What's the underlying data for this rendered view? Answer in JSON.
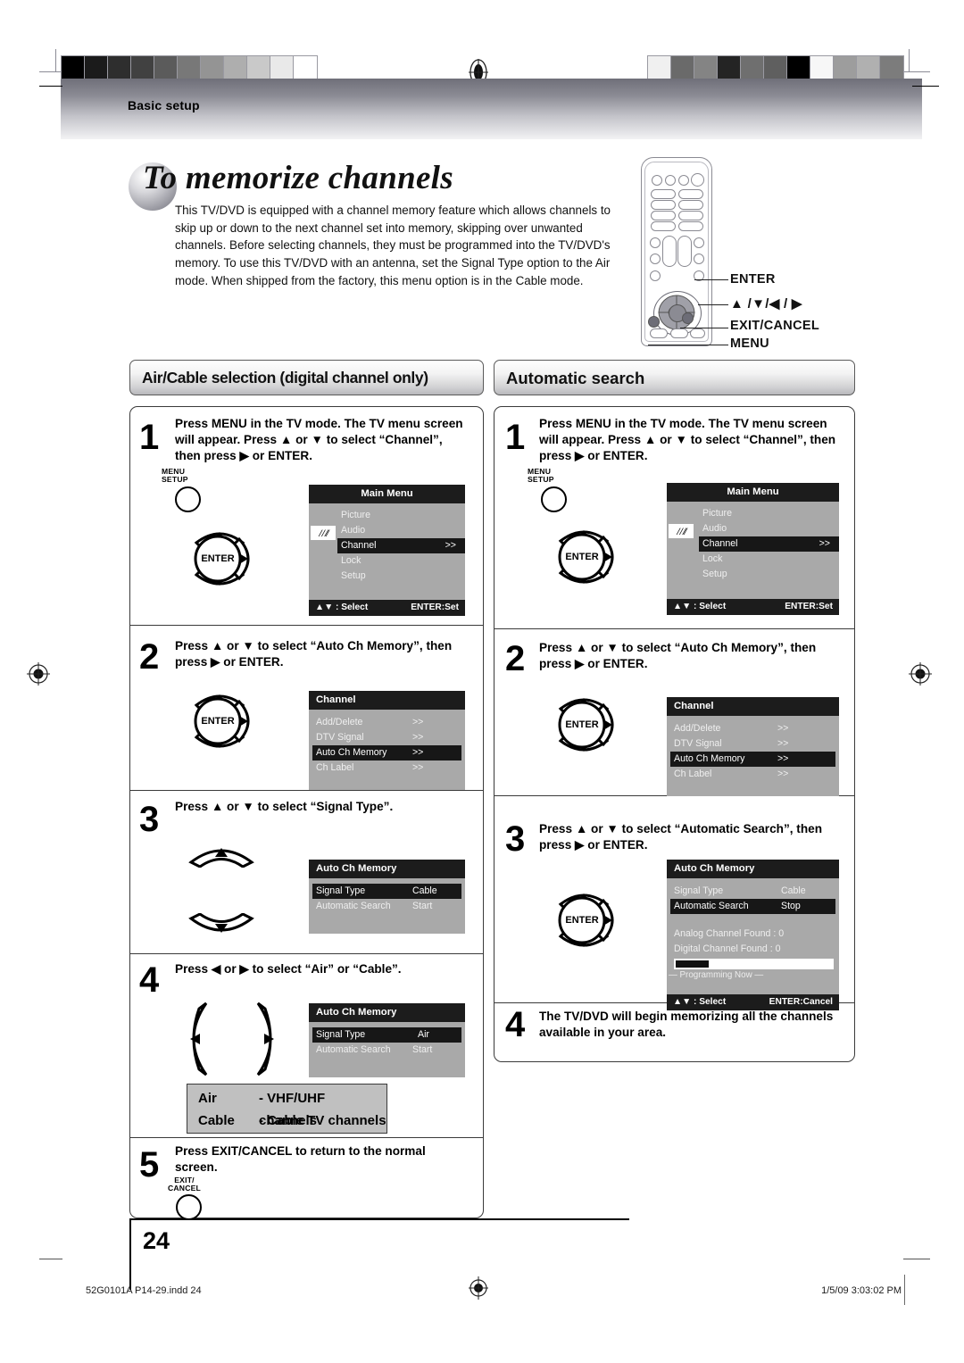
{
  "header": {
    "section_label": "Basic setup"
  },
  "title": {
    "lead": "To",
    "rest": "memorize channels"
  },
  "intro": "This TV/DVD is equipped with a channel memory feature which allows channels to skip up or down to the next channel set into memory, skipping over unwanted channels. Before selecting channels, they must be programmed into the TV/DVD's memory. To use this TV/DVD with an antenna, set the Signal Type option to the Air mode. When shipped from the factory, this menu option is in the Cable mode.",
  "remote_callouts": [
    "ENTER",
    "▲ /▼/◀ / ▶",
    "EXIT/CANCEL",
    "MENU"
  ],
  "left_column": {
    "heading": "Air/Cable selection (digital channel only)",
    "steps": [
      {
        "number": "1",
        "text": "Press MENU in the TV mode. The TV menu screen will appear. Press ▲ or ▼ to select “Channel”, then press ▶ or ENTER.",
        "button_caption": "MENU\nSETUP",
        "enter_label": "ENTER",
        "osd": {
          "title": "Main Menu",
          "title_align": "center",
          "rows": [
            {
              "label": "Picture",
              "value": "",
              "highlight": false
            },
            {
              "label": "Audio",
              "value": "",
              "highlight": false
            },
            {
              "label": "Channel",
              "value": ">>",
              "highlight": true
            },
            {
              "label": "Lock",
              "value": "",
              "highlight": false
            },
            {
              "label": "Setup",
              "value": "",
              "highlight": false
            }
          ],
          "footer_left": "▲▼ : Select",
          "footer_right": "ENTER:Set",
          "antenna_icon": "antenna-icon"
        }
      },
      {
        "number": "2",
        "text": "Press ▲ or ▼ to select “Auto Ch Memory”, then press ▶ or ENTER.",
        "enter_label": "ENTER",
        "osd": {
          "title": "Channel",
          "title_align": "left",
          "rows": [
            {
              "label": "Add/Delete",
              "value": ">>",
              "highlight": false
            },
            {
              "label": "DTV Signal",
              "value": ">>",
              "highlight": false
            },
            {
              "label": "Auto Ch Memory",
              "value": ">>",
              "highlight": true
            },
            {
              "label": "Ch Label",
              "value": ">>",
              "highlight": false
            }
          ]
        }
      },
      {
        "number": "3",
        "text": "Press ▲ or ▼ to select “Signal Type”.",
        "osd": {
          "title": "Auto Ch Memory",
          "title_align": "left",
          "rows": [
            {
              "label": "Signal Type",
              "value": "Cable",
              "highlight": true
            },
            {
              "label": "Automatic Search",
              "value": "Start",
              "highlight": false
            }
          ]
        }
      },
      {
        "number": "4",
        "text": "Press ◀ or ▶ to select “Air” or “Cable”.",
        "osd": {
          "title": "Auto Ch Memory",
          "title_align": "left",
          "rows": [
            {
              "label": "Signal Type",
              "value": "Air",
              "highlight": true
            },
            {
              "label": "Automatic Search",
              "value": "Start",
              "highlight": false
            }
          ]
        }
      },
      {
        "number": "5",
        "text": "Press EXIT/CANCEL to return to the normal screen.",
        "button_caption": "EXIT/\nCANCEL"
      }
    ],
    "legend": [
      {
        "key": "Air",
        "value": "- VHF/UHF channels"
      },
      {
        "key": "Cable",
        "value": "- Cable TV channels"
      }
    ]
  },
  "right_column": {
    "heading": "Automatic search",
    "steps": [
      {
        "number": "1",
        "text": "Press MENU in the TV mode. The TV menu screen will appear. Press ▲ or ▼ to select “Channel”, then press ▶ or ENTER.",
        "button_caption": "MENU\nSETUP",
        "enter_label": "ENTER",
        "osd": {
          "title": "Main Menu",
          "title_align": "center",
          "rows": [
            {
              "label": "Picture",
              "value": "",
              "highlight": false
            },
            {
              "label": "Audio",
              "value": "",
              "highlight": false
            },
            {
              "label": "Channel",
              "value": ">>",
              "highlight": true
            },
            {
              "label": "Lock",
              "value": "",
              "highlight": false
            },
            {
              "label": "Setup",
              "value": "",
              "highlight": false
            }
          ],
          "footer_left": "▲▼ : Select",
          "footer_right": "ENTER:Set",
          "antenna_icon": "antenna-icon"
        }
      },
      {
        "number": "2",
        "text": "Press ▲ or ▼ to select “Auto Ch Memory”, then press ▶ or ENTER.",
        "enter_label": "ENTER",
        "osd": {
          "title": "Channel",
          "title_align": "left",
          "rows": [
            {
              "label": "Add/Delete",
              "value": ">>",
              "highlight": false
            },
            {
              "label": "DTV Signal",
              "value": ">>",
              "highlight": false
            },
            {
              "label": "Auto Ch Memory",
              "value": ">>",
              "highlight": true
            },
            {
              "label": "Ch Label",
              "value": ">>",
              "highlight": false
            }
          ]
        }
      },
      {
        "number": "3",
        "text": "Press ▲ or ▼ to select “Automatic Search”, then press ▶ or ENTER.",
        "enter_label": "ENTER",
        "osd": {
          "title": "Auto Ch Memory",
          "title_align": "left",
          "rows": [
            {
              "label": "Signal Type",
              "value": "Cable",
              "highlight": false
            },
            {
              "label": "Automatic Search",
              "value": "Stop",
              "highlight": true
            }
          ],
          "analog_found": "Analog Channel Found : 0",
          "digital_found": "Digital Channel Found : 0",
          "progress_label": "— Programming Now —",
          "progress_percent": 21,
          "footer_left": "▲▼ : Select",
          "footer_right": "ENTER:Cancel"
        }
      },
      {
        "number": "4",
        "text": "The TV/DVD will begin memorizing all the channels available in your area."
      }
    ]
  },
  "footer": {
    "page_number": "24",
    "file_name": "52G0101A  P14-29.indd   24",
    "timestamp": "1/5/09   3:03:02 PM"
  },
  "colorbars": {
    "left": [
      "#000000",
      "#1b1b1b",
      "#2e2e2e",
      "#414141",
      "#5b5b5b",
      "#787878",
      "#949494",
      "#aeaeae",
      "#c9c9c9",
      "#e9e9e9",
      "#ffffff"
    ],
    "right": [
      "#f0f0f0",
      "#6a6a6a",
      "#848484",
      "#242424",
      "#6f6f6f",
      "#5f5f5f",
      "#000000",
      "#f7f7f7",
      "#9d9d9d",
      "#b0b0b0",
      "#7c7c7c"
    ]
  }
}
